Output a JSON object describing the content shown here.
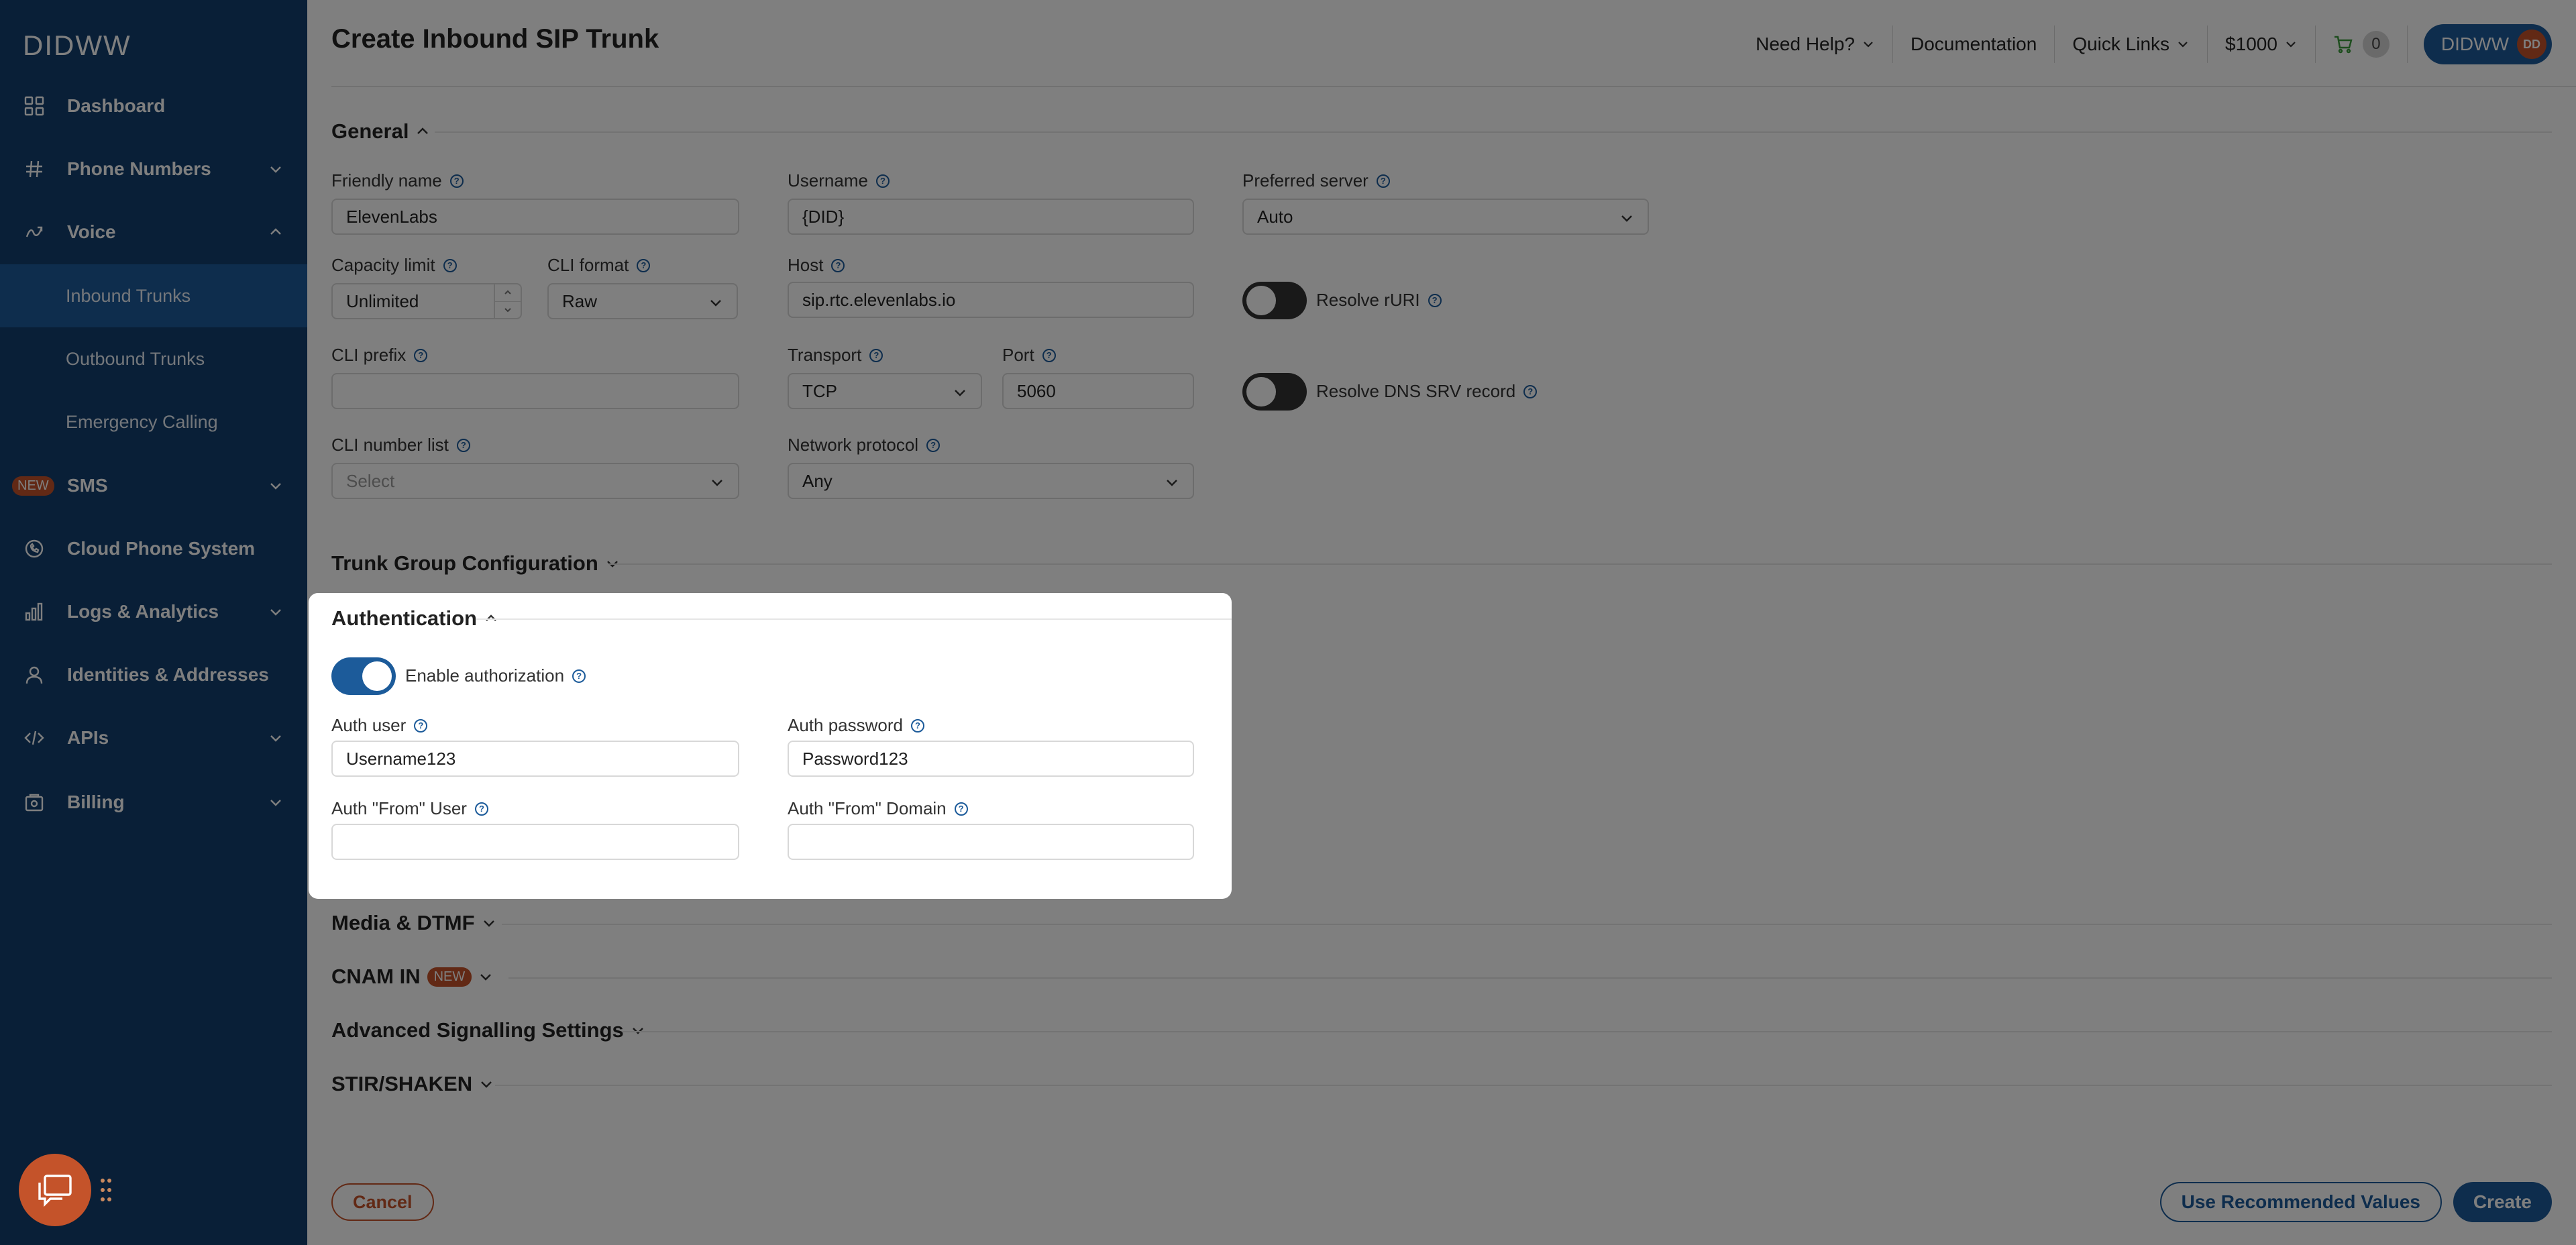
{
  "brand": {
    "logo": "DIDWW"
  },
  "sidebar": {
    "items": [
      {
        "label": "Dashboard",
        "icon": "grid-icon"
      },
      {
        "label": "Phone Numbers",
        "icon": "hash-icon"
      },
      {
        "label": "Voice",
        "icon": "voice-icon"
      },
      {
        "label": "Inbound Trunks"
      },
      {
        "label": "Outbound Trunks"
      },
      {
        "label": "Emergency Calling"
      },
      {
        "label": "SMS",
        "badge": "NEW",
        "icon": "chevron-down-icon"
      },
      {
        "label": "Cloud Phone System",
        "icon": "phone-circle-icon"
      },
      {
        "label": "Logs & Analytics",
        "icon": "bar-chart-icon"
      },
      {
        "label": "Identities & Addresses",
        "icon": "user-icon"
      },
      {
        "label": "APIs",
        "icon": "code-icon"
      },
      {
        "label": "Billing",
        "icon": "billing-icon"
      }
    ]
  },
  "header": {
    "title": "Create Inbound SIP Trunk",
    "need_help": "Need Help?",
    "documentation": "Documentation",
    "quick_links": "Quick Links",
    "balance": "$1000",
    "cart_count": "0",
    "account": "DIDWW",
    "avatar_initials": "DD"
  },
  "general": {
    "title": "General",
    "friendly_name": {
      "label": "Friendly name",
      "value": "ElevenLabs"
    },
    "username": {
      "label": "Username",
      "value": "{DID}"
    },
    "preferred_server": {
      "label": "Preferred server",
      "value": "Auto"
    },
    "capacity_limit": {
      "label": "Capacity limit",
      "value": "Unlimited"
    },
    "cli_format": {
      "label": "CLI format",
      "value": "Raw"
    },
    "host": {
      "label": "Host",
      "value": "sip.rtc.elevenlabs.io"
    },
    "resolve_ruri": {
      "label": "Resolve rURI"
    },
    "cli_prefix": {
      "label": "CLI prefix",
      "value": ""
    },
    "transport": {
      "label": "Transport",
      "value": "TCP"
    },
    "port": {
      "label": "Port",
      "value": "5060"
    },
    "resolve_dns": {
      "label": "Resolve DNS SRV record"
    },
    "cli_number_list": {
      "label": "CLI number list",
      "placeholder": "Select"
    },
    "network_protocol": {
      "label": "Network protocol",
      "value": "Any"
    }
  },
  "sections": {
    "trunk_group": "Trunk Group Configuration",
    "media_dtmf": "Media & DTMF",
    "cnam_in": "CNAM IN",
    "cnam_badge": "NEW",
    "advanced": "Advanced Signalling Settings",
    "stir": "STIR/SHAKEN"
  },
  "auth": {
    "title": "Authentication",
    "enable_label": "Enable authorization",
    "auth_user": {
      "label": "Auth user",
      "value": "Username123"
    },
    "auth_password": {
      "label": "Auth password",
      "value": "Password123"
    },
    "from_user": {
      "label": "Auth \"From\" User",
      "value": ""
    },
    "from_domain": {
      "label": "Auth \"From\" Domain",
      "value": ""
    }
  },
  "footer": {
    "cancel": "Cancel",
    "recommended": "Use Recommended Values",
    "create": "Create"
  },
  "colors": {
    "sidebar_bg": "#123e6e",
    "primary": "#1c5b9a",
    "accent": "#c4532a"
  }
}
